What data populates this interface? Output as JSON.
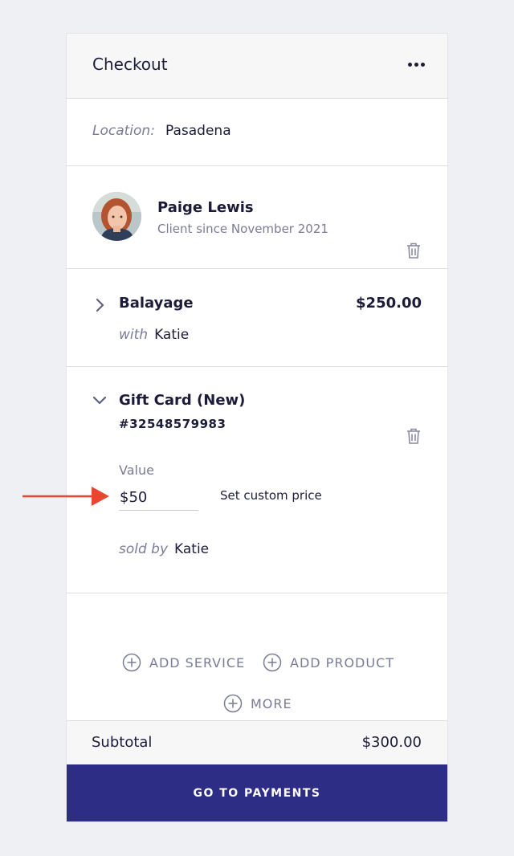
{
  "header": {
    "title": "Checkout",
    "more_icon": "more-horizontal-icon"
  },
  "location": {
    "label": "Location:",
    "value": "Pasadena"
  },
  "client": {
    "name": "Paige Lewis",
    "since": "Client since November 2021",
    "delete_icon": "trash-icon"
  },
  "service": {
    "name": "Balayage",
    "price": "$250.00",
    "with_label": "with",
    "staff": "Katie",
    "expand_icon": "chevron-right-icon"
  },
  "gift_card": {
    "name": "Gift Card (New)",
    "number": "#32548579983",
    "value_label": "Value",
    "value": "$50",
    "custom_price_label": "Set custom price",
    "sold_by_label": "sold by",
    "sold_by": "Katie",
    "collapse_icon": "chevron-down-icon",
    "delete_icon": "trash-icon"
  },
  "actions": {
    "add_service": "ADD SERVICE",
    "add_product": "ADD PRODUCT",
    "more": "MORE"
  },
  "summary": {
    "subtotal_label": "Subtotal",
    "subtotal_value": "$300.00"
  },
  "footer": {
    "pay_button": "GO TO PAYMENTS"
  },
  "colors": {
    "background": "#eef0f4",
    "primary_button": "#2e2d86",
    "text_primary": "#1c1c3a",
    "text_muted": "#7a7c97",
    "annotation_arrow": "#e8472f"
  }
}
